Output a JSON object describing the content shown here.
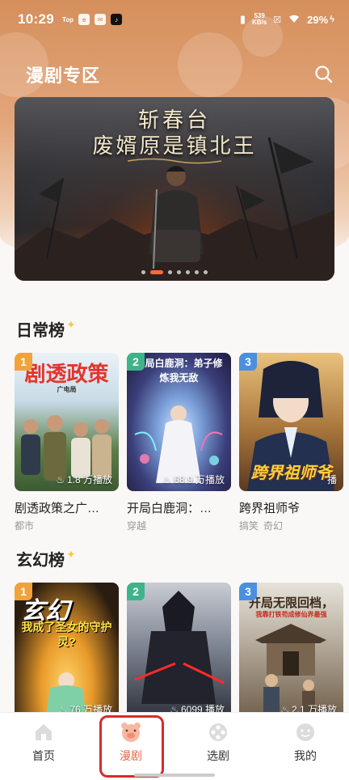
{
  "status_bar": {
    "time": "10:29",
    "apps": [
      "Top",
      "e",
      "✉",
      "♪"
    ],
    "net_speed_top": "539",
    "net_speed_bottom": "KB/s",
    "battery": "29%"
  },
  "header": {
    "title": "漫剧专区"
  },
  "banner": {
    "title_line1": "斩春台",
    "title_line2": "废婿原是镇北王",
    "page_count": 7,
    "active_index": 1
  },
  "sections": [
    {
      "title": "日常榜",
      "cards": [
        {
          "rank": "1",
          "cover_text": "剧透政策",
          "cover_subtext": "广电局",
          "plays": "1.8 万播放",
          "title": "剧透政策之广…",
          "tags": [
            "都市"
          ]
        },
        {
          "rank": "2",
          "cover_text": "开局白鹿洞：弟子修炼我无敌",
          "cover_subtext": "",
          "plays": "68.9 万播放",
          "title": "开局白鹿洞：…",
          "tags": [
            "穿越"
          ]
        },
        {
          "rank": "3",
          "cover_text": "跨界祖师爷",
          "cover_subtext": "",
          "plays": "播",
          "title": "跨界祖师爷",
          "tags": [
            "搞笑",
            "奇幻"
          ]
        }
      ]
    },
    {
      "title": "玄幻榜",
      "cards": [
        {
          "rank": "1",
          "cover_text": "玄幻",
          "cover_subtext": "我成了圣女的守护灵?",
          "plays": "76 万播放",
          "title": "",
          "tags": []
        },
        {
          "rank": "2",
          "cover_text": "",
          "cover_subtext": "",
          "plays": "6099 播放",
          "title": "",
          "tags": []
        },
        {
          "rank": "3",
          "cover_text": "开局无限回档，",
          "cover_subtext": "我靠打铁苟成修仙界最强",
          "plays": "2.1 万播放",
          "title": "",
          "tags": []
        }
      ]
    }
  ],
  "bottom_nav": [
    {
      "label": "首页",
      "icon": "home-icon",
      "active": false
    },
    {
      "label": "漫剧",
      "icon": "pig-icon",
      "active": true
    },
    {
      "label": "选剧",
      "icon": "film-reel-icon",
      "active": false
    },
    {
      "label": "我的",
      "icon": "profile-icon",
      "active": false
    }
  ],
  "colors": {
    "accent": "#e56a44",
    "header_gradient_top": "#d58f5c",
    "highlight_box": "#d62c2c"
  }
}
